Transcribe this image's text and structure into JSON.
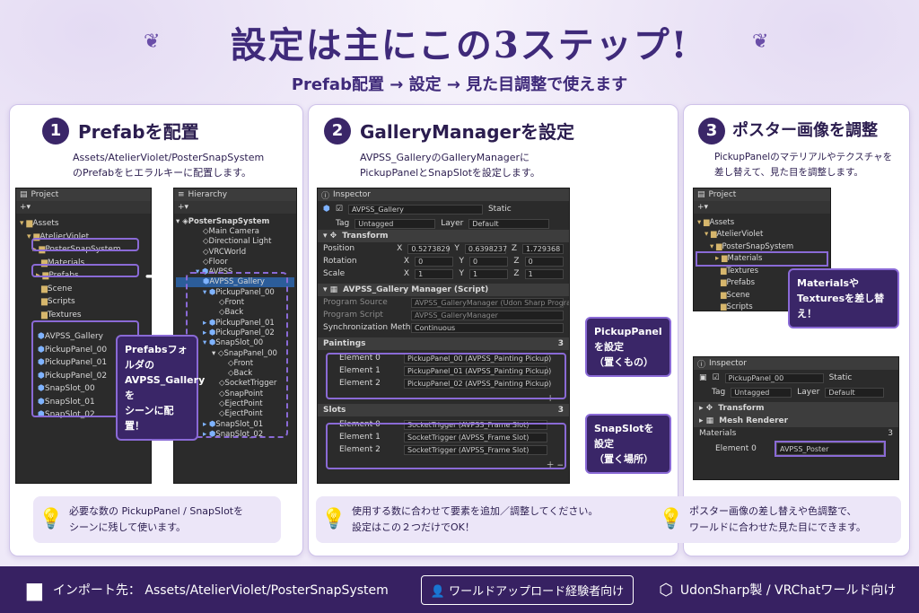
{
  "header": {
    "title": "設定は主にこの3ステップ!",
    "subtitle": "Prefab配置 → 設定 → 見た目調整で使えます"
  },
  "steps": [
    {
      "num": "1",
      "title": "Prefabを配置",
      "desc1": "Assets/AtelierViolet/PosterSnapSystem",
      "desc2": "のPrefabをヒエラルキーに配置します。",
      "tip1": "必要な数の PickupPanel / SnapSlotを",
      "tip2": "シーンに残して使います。"
    },
    {
      "num": "2",
      "title": "GalleryManagerを設定",
      "desc1": "AVPSS_GalleryのGalleryManagerに",
      "desc2": "PickupPanelとSnapSlotを設定します。",
      "tip1": "使用する数に合わせて要素を追加／調整してください。",
      "tip2": "設定はこの２つだけでOK！"
    },
    {
      "num": "3",
      "title": "ポスター画像を調整",
      "desc1": "PickupPanelのマテリアルやテクスチャを",
      "desc2": "差し替えて、見た目を調整します。",
      "tip1": "ポスター画像の差し替えや色調整で、",
      "tip2": "ワールドに合わせた見た目にできます。"
    }
  ],
  "project1": {
    "tab": "Project",
    "items": [
      "Assets",
      "AtelierViolet",
      "PosterSnapSystem",
      "Materials",
      "Prefabs",
      "Scene",
      "Scripts",
      "Textures"
    ],
    "prefabs": [
      "AVPSS_Gallery",
      "PickupPanel_00",
      "PickupPanel_01",
      "PickupPanel_02",
      "SnapSlot_00",
      "SnapSlot_01",
      "SnapSlot_02"
    ]
  },
  "hierarchy": {
    "tab": "Hierarchy",
    "items": [
      "PosterSnapSystem",
      "Main Camera",
      "Directional Light",
      "VRCWorld",
      "Floor",
      "AVPSS",
      "AVPSS_Gallery",
      "PickupPanel_00",
      "Front",
      "Back",
      "PickupPanel_01",
      "PickupPanel_02",
      "SnapSlot_00",
      "SnapPanel_00",
      "Front",
      "Back",
      "SocketTrigger",
      "SnapPoint",
      "EjectPoint",
      "EjectPoint",
      "SnapSlot_01",
      "SnapSlot_02"
    ]
  },
  "callout1": {
    "l1": "Prefabsフォルダの",
    "l2": "AVPSS_Galleryを",
    "l3": "シーンに配置！"
  },
  "inspector2": {
    "tab": "Inspector",
    "obj": "AVPSS_Gallery",
    "static": "Static",
    "tag_label": "Tag",
    "tag": "Untagged",
    "layer_label": "Layer",
    "layer": "Default",
    "transform": "Transform",
    "pos": "Position",
    "rot": "Rotation",
    "scale": "Scale",
    "px": "0.5273829",
    "py": "0.6398237",
    "pz": "1.729368",
    "rx": "0",
    "ry": "0",
    "rz": "0",
    "sx": "1",
    "sy": "1",
    "sz": "1",
    "script": "AVPSS_Gallery Manager (Script)",
    "ps_label": "Program Source",
    "ps": "AVPSS_GalleryManager (Udon Sharp Program",
    "pscript_label": "Program Script",
    "pscript": "AVPSS_GalleryManager",
    "sync_label": "Synchronization Method",
    "sync": "Continuous",
    "paintings": "Paintings",
    "pcount": "3",
    "pel": [
      "Element 0",
      "Element 1",
      "Element 2"
    ],
    "pvals": [
      "PickupPanel_00 (AVPSS_Painting Pickup)",
      "PickupPanel_01 (AVPSS_Painting Pickup)",
      "PickupPanel_02 (AVPSS_Painting Pickup)"
    ],
    "slots": "Slots",
    "scount": "3",
    "svals": [
      "SocketTrigger (AVPSS_Frame Slot)",
      "SocketTrigger (AVPSS_Frame Slot)",
      "SocketTrigger (AVPSS_Frame Slot)"
    ]
  },
  "callout2a": {
    "l1": "PickupPanelを設定",
    "l2": "（置くもの）"
  },
  "callout2b": {
    "l1": "SnapSlotを設定",
    "l2": "（置く場所）"
  },
  "project3": {
    "tab": "Project",
    "items": [
      "Assets",
      "AtelierViolet",
      "PosterSnapSystem",
      "Materials",
      "Textures",
      "Prefabs",
      "Scene",
      "Scripts"
    ]
  },
  "callout3": {
    "l1": "Materialsや",
    "l2": "Texturesを差し替え！"
  },
  "inspector3": {
    "tab": "Inspector",
    "obj": "PickupPanel_00",
    "static": "Static",
    "tag_label": "Tag",
    "tag": "Untagged",
    "layer_label": "Layer",
    "layer": "Default",
    "transform": "Transform",
    "renderer": "Mesh Renderer",
    "materials": "Materials",
    "mcount": "3",
    "el": "Element 0",
    "mat": "AVPSS_Poster"
  },
  "footer": {
    "import": "インポート先： Assets/AtelierViolet/PosterSnapSystem",
    "audience": "ワールドアップロード経験者向け",
    "tech": "UdonSharp製 / VRChatワールド向け"
  }
}
